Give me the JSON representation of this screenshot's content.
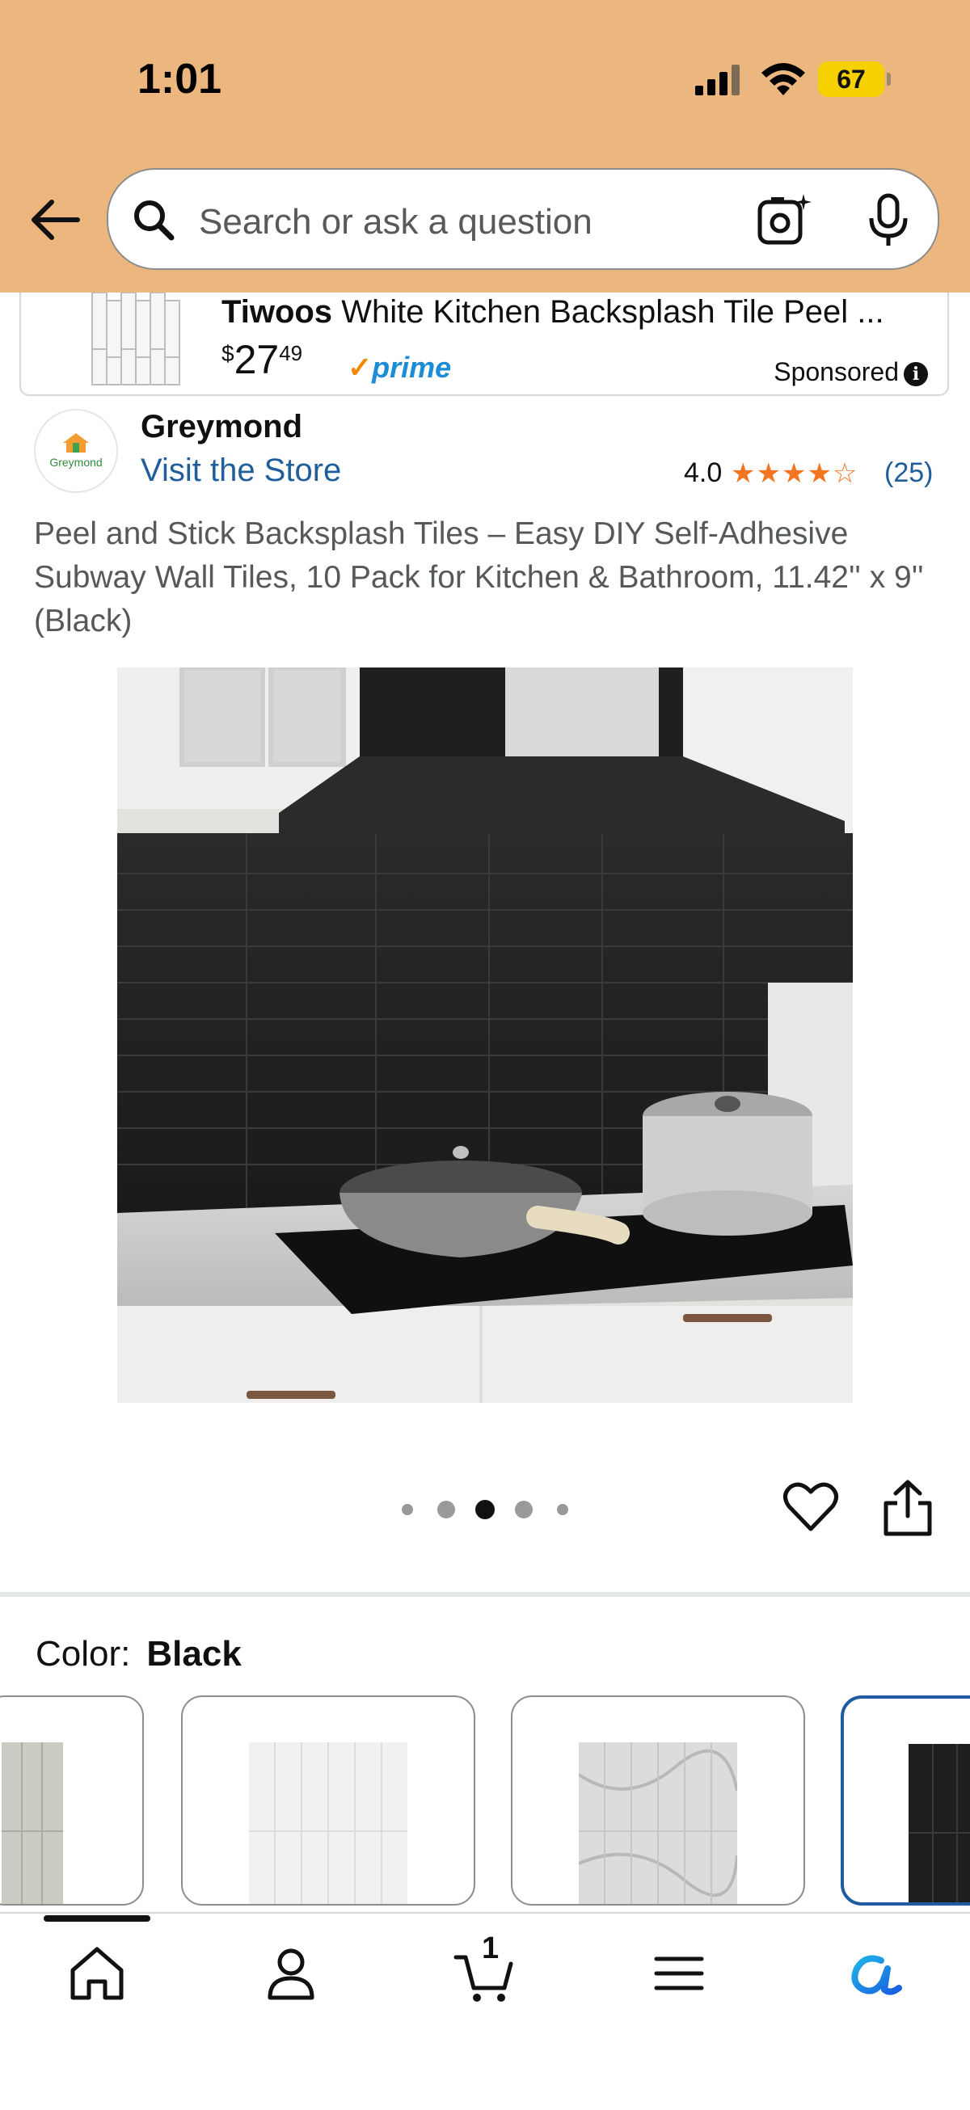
{
  "status_bar": {
    "time": "1:01",
    "battery": "67"
  },
  "search": {
    "placeholder": "Search or ask a question"
  },
  "sponsored": {
    "brand": "Tiwoos",
    "title": "White Kitchen Backsplash Tile Peel ...",
    "price_currency": "$",
    "price_whole": "27",
    "price_fraction": "49",
    "prime_label": "prime",
    "label": "Sponsored"
  },
  "store": {
    "logo_text": "Greymond",
    "seller_name": "Greymond",
    "visit_link": "Visit the Store",
    "rating": "4.0",
    "stars": "★★★★☆",
    "review_count": "(25)"
  },
  "product": {
    "title": "Peel and Stick Backsplash Tiles – Easy DIY Self-Adhesive Subway Wall Tiles, 10 Pack for Kitchen & Bathroom, 11.42'' x 9'' (Black)",
    "image_carousel": {
      "total": 5,
      "active": 3
    }
  },
  "color": {
    "label": "Color:",
    "selected": "Black"
  },
  "tabbar": {
    "cart_count": "1"
  },
  "icons": {
    "back": "arrow-left-icon",
    "search": "search-icon",
    "lens": "camera-lens-icon",
    "mic": "microphone-icon",
    "heart": "heart-icon",
    "share": "share-icon",
    "home": "home-icon",
    "account": "account-icon",
    "cart": "cart-icon",
    "menu": "menu-icon",
    "rufus": "rufus-icon"
  },
  "colors": {
    "header_bg": "#ecb77f",
    "link": "#1f5d9b",
    "star": "#f5741f",
    "selected_border": "#1f5da0"
  }
}
